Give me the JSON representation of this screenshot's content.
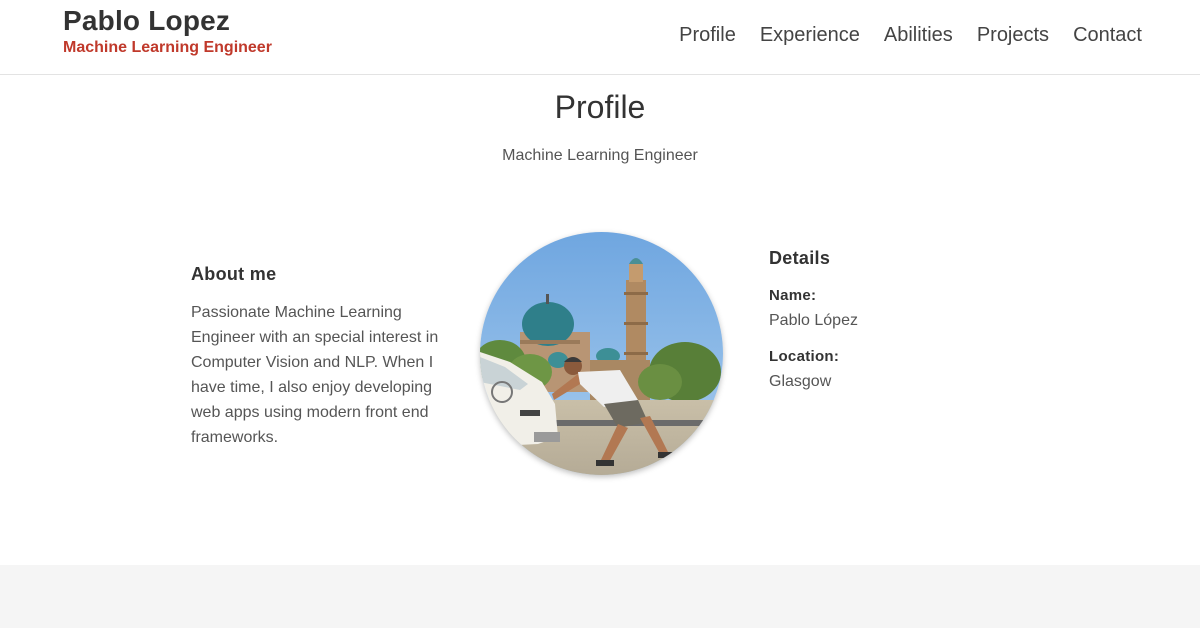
{
  "header": {
    "name": "Pablo Lopez",
    "tagline": "Machine Learning Engineer"
  },
  "nav": {
    "items": [
      {
        "label": "Profile"
      },
      {
        "label": "Experience"
      },
      {
        "label": "Abilities"
      },
      {
        "label": "Projects"
      },
      {
        "label": "Contact"
      }
    ]
  },
  "profile": {
    "title": "Profile",
    "subtitle": "Machine Learning Engineer",
    "about": {
      "heading": "About me",
      "text": "Passionate Machine Learning Engineer with an special interest in Computer Vision and NLP. When I have time, I also enjoy developing web apps using modern front end frameworks."
    },
    "details": {
      "heading": "Details",
      "name_label": "Name:",
      "name_value": "Pablo López",
      "location_label": "Location:",
      "location_value": "Glasgow"
    }
  },
  "colors": {
    "accent": "#c0392b",
    "text": "#333333",
    "footer_band": "#f5f5f5"
  }
}
